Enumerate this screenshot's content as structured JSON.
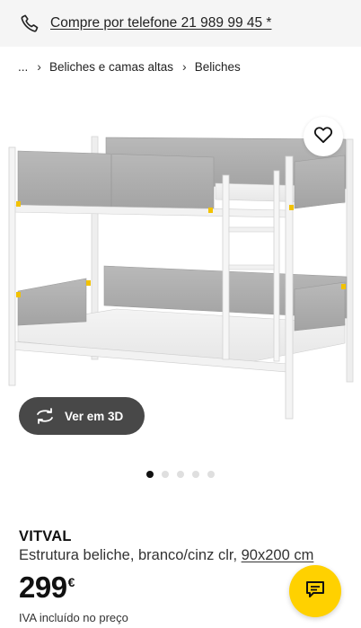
{
  "top_bar": {
    "phone_label": "Compre por telefone 21 989 99 45 *",
    "icon": "phone-icon"
  },
  "breadcrumb": {
    "ellipsis": "...",
    "items": [
      "Beliches e camas altas",
      "Beliches"
    ]
  },
  "gallery": {
    "favourite_icon": "heart-icon",
    "view_3d_label": "Ver em 3D",
    "view_3d_icon": "rotate-3d-icon",
    "slide_count": 5,
    "active_slide": 1
  },
  "product": {
    "brand": "VITVAL",
    "description": "Estrutura beliche, branco/cinz clr, ",
    "size": "90x200 cm",
    "price": "299",
    "currency": "€",
    "vat_note": "IVA incluído no preço"
  },
  "chat": {
    "icon": "chat-icon"
  },
  "colors": {
    "accent_yellow": "#ffd100",
    "button_dark": "#484848",
    "top_bar_bg": "#f5f5f5"
  }
}
